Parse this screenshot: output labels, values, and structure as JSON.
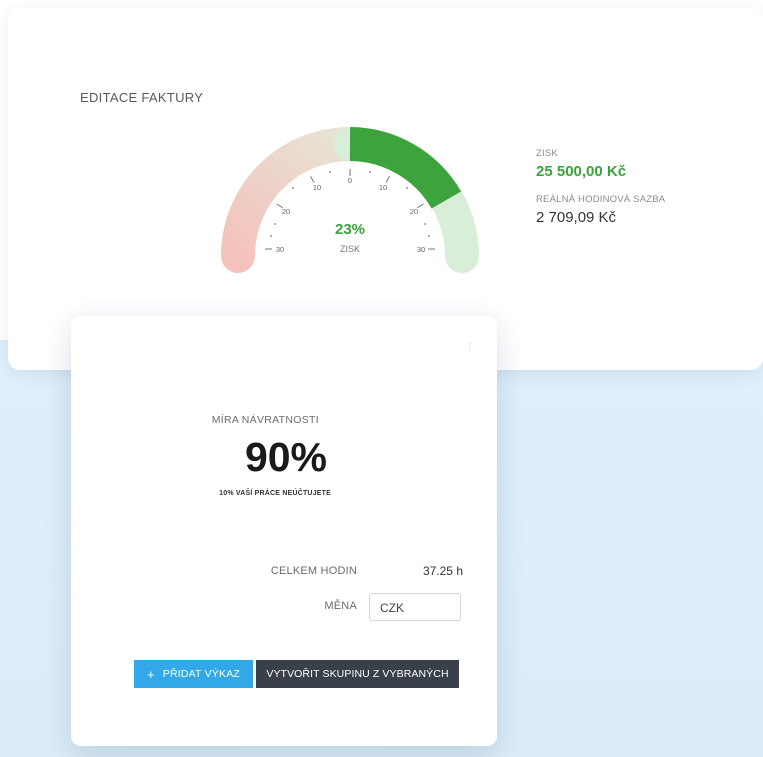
{
  "top_card": {
    "title": "EDITACE FAKTURY",
    "gauge": {
      "percent_label": "23%",
      "percent_value": 23,
      "sub_label": "ZISK",
      "tick_labels": [
        "30",
        "20",
        "10",
        "0",
        "10",
        "20",
        "30"
      ]
    },
    "stats": {
      "profit_label": "ZISK",
      "profit_value": "25 500,00 Kč",
      "rate_label": "REÁLNÁ HODINOVÁ SAZBA",
      "rate_value": "2 709,09 Kč"
    },
    "colors": {
      "green": "#3aa33a",
      "red_fade": "#f0c0b8",
      "light_green": "#d9eed9"
    }
  },
  "front_card": {
    "return_rate_label": "MÍRA NÁVRATNOSTI",
    "return_rate_value": "90%",
    "return_rate_note": "10% VAŠÍ PRÁCE NEÚČTUJETE",
    "total_hours_label": "CELKEM HODIN",
    "total_hours_value": "37.25 h",
    "currency_label": "MĚNA",
    "currency_value": "CZK",
    "add_button_icon": "+",
    "add_button_label": "PŘIDAT VÝKAZ",
    "group_button_label": "VYTVOŘIT SKUPINU Z VYBRANÝCH"
  }
}
